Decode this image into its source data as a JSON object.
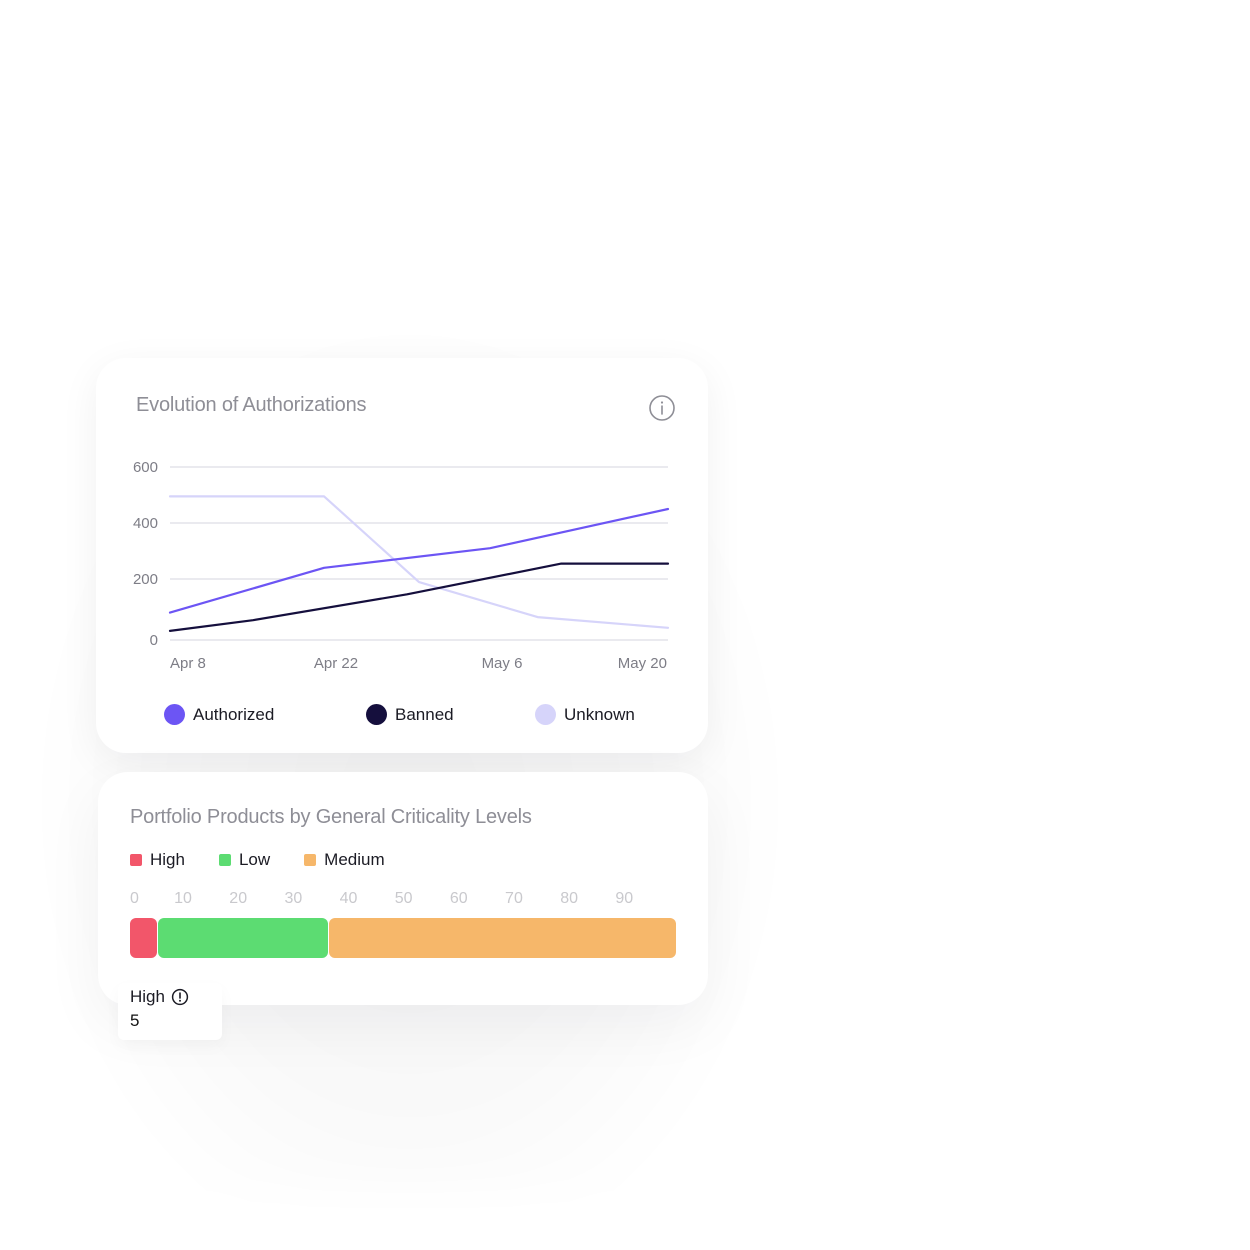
{
  "auth_card": {
    "title": "Evolution of Authorizations",
    "info_icon": "info-circle-icon"
  },
  "criticality_card": {
    "title": "Portfolio Products by General Criticality Levels",
    "legend": [
      {
        "label": "High",
        "color": "#f2566a"
      },
      {
        "label": "Low",
        "color": "#5cdc72"
      },
      {
        "label": "Medium",
        "color": "#f6b76a"
      }
    ],
    "scale_ticks": [
      "0",
      "10",
      "20",
      "30",
      "40",
      "50",
      "60",
      "70",
      "80",
      "90"
    ],
    "tooltip": {
      "label": "High",
      "value": "5",
      "icon": "alert-circle-icon"
    }
  },
  "chart_data": [
    {
      "type": "line",
      "title": "Evolution of Authorizations",
      "xlabel": "",
      "ylabel": "",
      "x_ticks": [
        "Apr 8",
        "Apr 22",
        "May 6",
        "May 20"
      ],
      "x_range_days": [
        0,
        42
      ],
      "y_ticks": [
        0,
        200,
        400,
        600
      ],
      "ylim": [
        0,
        600
      ],
      "grid": "horizontal",
      "legend_position": "bottom",
      "series": [
        {
          "name": "Authorized",
          "color": "#6c55f4",
          "points": [
            {
              "x": "Apr 8",
              "day": 0,
              "y": 90
            },
            {
              "x": "Apr 21",
              "day": 13,
              "y": 240
            },
            {
              "x": "May 5",
              "day": 27,
              "y": 310
            },
            {
              "x": "May 20",
              "day": 42,
              "y": 450
            }
          ]
        },
        {
          "name": "Banned",
          "color": "#150f3d",
          "points": [
            {
              "x": "Apr 8",
              "day": 0,
              "y": 30
            },
            {
              "x": "Apr 15",
              "day": 7,
              "y": 65
            },
            {
              "x": "Apr 28",
              "day": 20,
              "y": 150
            },
            {
              "x": "May 11",
              "day": 33,
              "y": 255
            },
            {
              "x": "May 20",
              "day": 42,
              "y": 255
            }
          ]
        },
        {
          "name": "Unknown",
          "color": "#d6d4fa",
          "points": [
            {
              "x": "Apr 8",
              "day": 0,
              "y": 495
            },
            {
              "x": "Apr 21",
              "day": 13,
              "y": 495
            },
            {
              "x": "Apr 29",
              "day": 21,
              "y": 190
            },
            {
              "x": "May 9",
              "day": 31,
              "y": 75
            },
            {
              "x": "May 20",
              "day": 42,
              "y": 40
            }
          ]
        }
      ]
    },
    {
      "type": "bar",
      "orientation": "horizontal-stacked",
      "title": "Portfolio Products by General Criticality Levels",
      "categories": [
        "High",
        "Low",
        "Medium"
      ],
      "values": [
        5,
        31,
        63
      ],
      "colors": [
        "#f2566a",
        "#5cdc72",
        "#f6b76a"
      ],
      "x_ticks": [
        0,
        10,
        20,
        30,
        40,
        50,
        60,
        70,
        80,
        90
      ],
      "xlim": [
        0,
        99
      ],
      "legend_position": "top-left"
    }
  ]
}
